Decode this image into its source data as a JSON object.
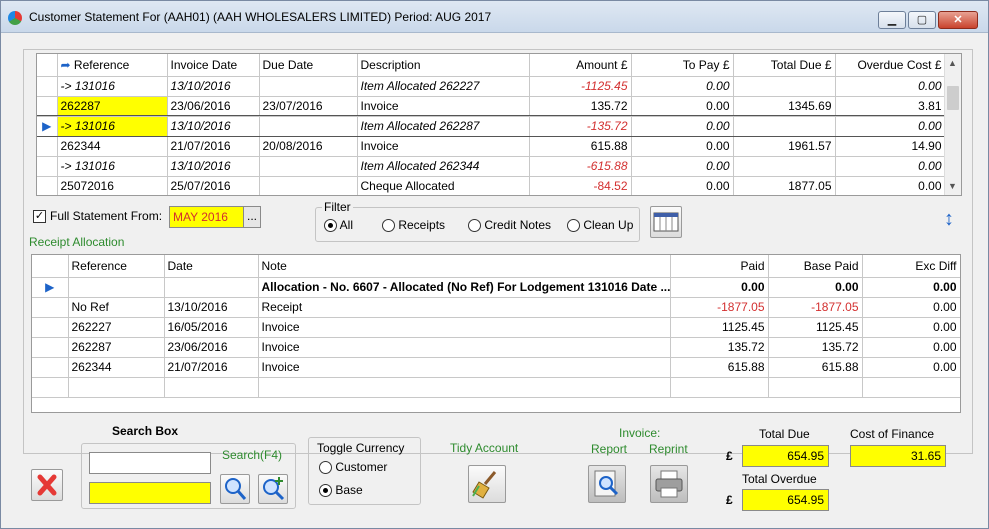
{
  "window": {
    "title": "Customer Statement For (AAH01) (AAH  WHOLESALERS LIMITED) Period: AUG 2017",
    "min_label": "▁",
    "max_label": "▢",
    "close_label": "✕"
  },
  "statement_grid": {
    "headers": [
      "Reference",
      "Invoice Date",
      "Due Date",
      "Description",
      "Amount £",
      "To Pay £",
      "Total Due £",
      "Overdue Cost £"
    ],
    "rows": [
      {
        "indicator": "",
        "ref": "-> 131016",
        "invoice_date": "13/10/2016",
        "due_date": "",
        "description": "Item Allocated 262227",
        "amount": "-1125.45",
        "to_pay": "0.00",
        "total_due": "",
        "overdue_cost": "0.00",
        "italic": true,
        "negative": true,
        "hl": false
      },
      {
        "indicator": "",
        "ref": "262287",
        "invoice_date": "23/06/2016",
        "due_date": "23/07/2016",
        "description": "Invoice",
        "amount": "135.72",
        "to_pay": "0.00",
        "total_due": "1345.69",
        "overdue_cost": "3.81",
        "italic": false,
        "negative": false,
        "hl": true
      },
      {
        "indicator": "▶",
        "ref": "-> 131016",
        "invoice_date": "13/10/2016",
        "due_date": "",
        "description": "Item Allocated 262287",
        "amount": "-135.72",
        "to_pay": "0.00",
        "total_due": "",
        "overdue_cost": "0.00",
        "italic": true,
        "negative": true,
        "hl": true
      },
      {
        "indicator": "",
        "ref": "262344",
        "invoice_date": "21/07/2016",
        "due_date": "20/08/2016",
        "description": "Invoice",
        "amount": "615.88",
        "to_pay": "0.00",
        "total_due": "1961.57",
        "overdue_cost": "14.90",
        "italic": false,
        "negative": false,
        "hl": false
      },
      {
        "indicator": "",
        "ref": "-> 131016",
        "invoice_date": "13/10/2016",
        "due_date": "",
        "description": "Item Allocated 262344",
        "amount": "-615.88",
        "to_pay": "0.00",
        "total_due": "",
        "overdue_cost": "0.00",
        "italic": true,
        "negative": true,
        "hl": false
      },
      {
        "indicator": "",
        "ref": "25072016",
        "invoice_date": "25/07/2016",
        "due_date": "",
        "description": "Cheque Allocated",
        "amount": "-84.52",
        "to_pay": "0.00",
        "total_due": "1877.05",
        "overdue_cost": "0.00",
        "italic": false,
        "negative": true,
        "hl": false
      }
    ]
  },
  "full_statement": {
    "label": "Full Statement From:",
    "checked": "✓",
    "value": "MAY 2016",
    "button": "..."
  },
  "filter": {
    "title": "Filter",
    "options": [
      "All",
      "Receipts",
      "Credit Notes",
      "Clean Up"
    ],
    "selected": "All"
  },
  "receipt_allocation": {
    "title": "Receipt Allocation",
    "headers": [
      "Reference",
      "Date",
      "Note",
      "Paid",
      "Base Paid",
      "Exc Diff"
    ],
    "summary": {
      "note": "Allocation - No. 6607 - Allocated (No Ref) For Lodgement 131016 Date ...",
      "paid": "0.00",
      "base_paid": "0.00",
      "exc_diff": "0.00"
    },
    "rows": [
      {
        "ref": "No Ref",
        "date": "13/10/2016",
        "note": "Receipt",
        "paid": "-1877.05",
        "base_paid": "-1877.05",
        "exc_diff": "0.00",
        "negative": true
      },
      {
        "ref": "262227",
        "date": "16/05/2016",
        "note": "Invoice",
        "paid": "1125.45",
        "base_paid": "1125.45",
        "exc_diff": "0.00",
        "negative": false
      },
      {
        "ref": "262287",
        "date": "23/06/2016",
        "note": "Invoice",
        "paid": "135.72",
        "base_paid": "135.72",
        "exc_diff": "0.00",
        "negative": false
      },
      {
        "ref": "262344",
        "date": "21/07/2016",
        "note": "Invoice",
        "paid": "615.88",
        "base_paid": "615.88",
        "exc_diff": "0.00",
        "negative": false
      }
    ]
  },
  "search": {
    "title": "Search Box",
    "link": "Search(F4)",
    "input_value": "",
    "input2_value": ""
  },
  "toggle_currency": {
    "title": "Toggle Currency",
    "options": [
      "Customer",
      "Base"
    ],
    "selected": "Base"
  },
  "tidy_account": {
    "label": "Tidy Account"
  },
  "invoice": {
    "label": "Invoice:",
    "report": "Report",
    "reprint": "Reprint"
  },
  "totals": {
    "currency_symbol": "£",
    "total_due_label": "Total Due",
    "total_due": "654.95",
    "total_overdue_label": "Total Overdue",
    "total_overdue": "654.95",
    "cost_of_finance_label": "Cost of Finance",
    "cost_of_finance": "31.65"
  },
  "colors": {
    "highlight": "#ffff00",
    "negative": "#d32f2f",
    "green_label": "#2e8b2e"
  }
}
